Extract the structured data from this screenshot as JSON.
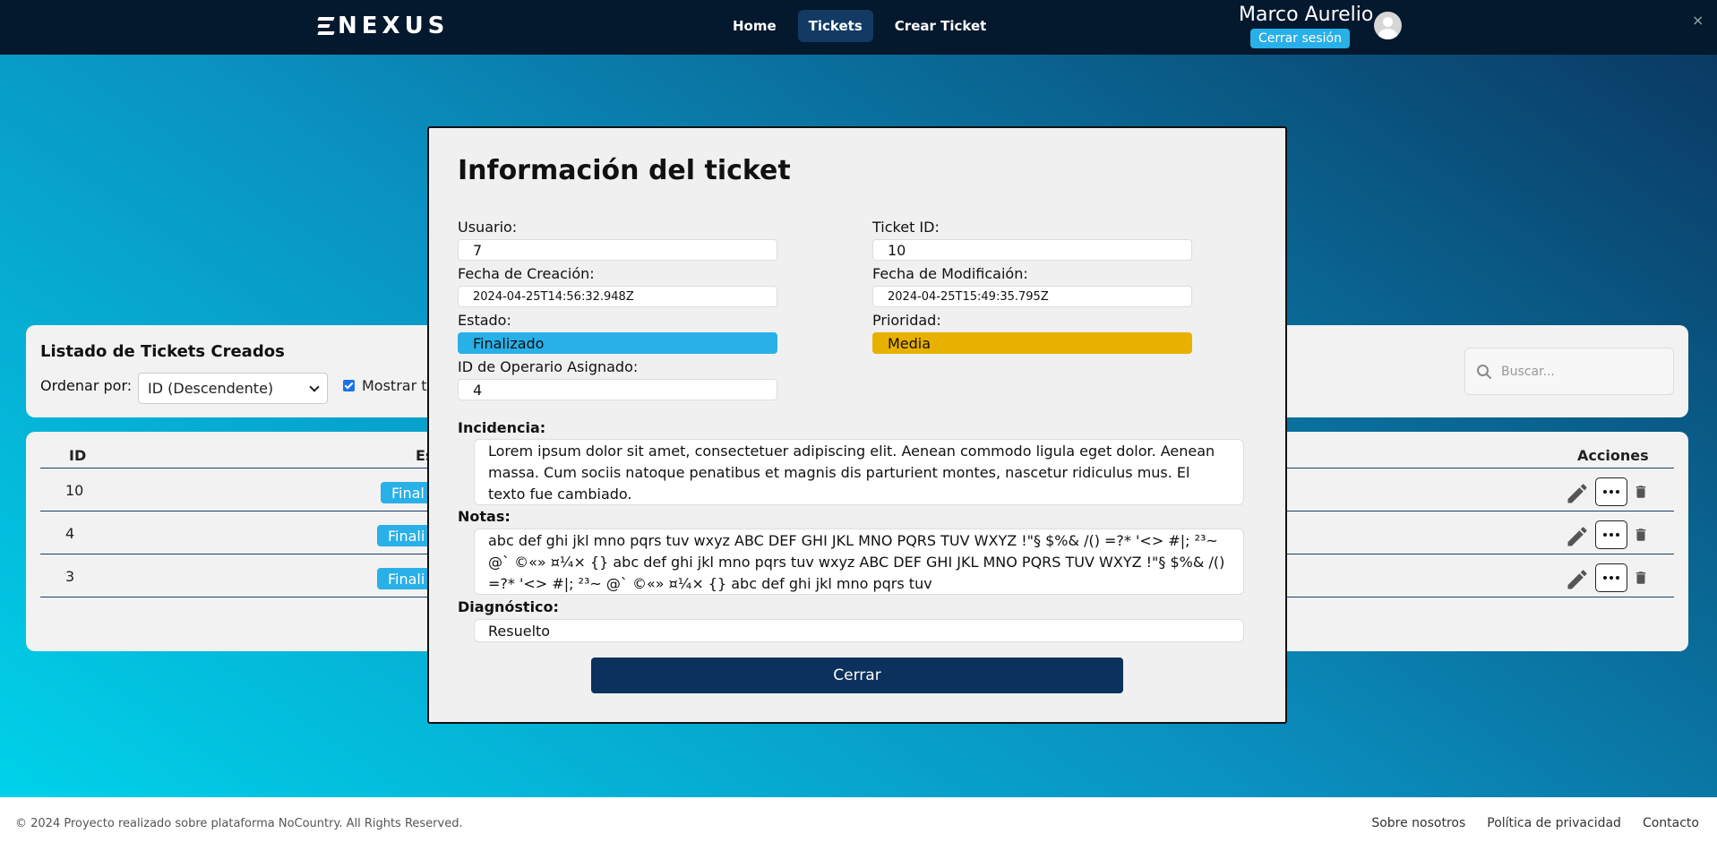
{
  "header": {
    "logo": "NEXUS",
    "nav": [
      {
        "label": "Home"
      },
      {
        "label": "Tickets"
      },
      {
        "label": "Crear Ticket"
      }
    ],
    "user_name": "Marco Aurelio",
    "logout_label": "Cerrar sesión",
    "close_glyph": "×"
  },
  "list": {
    "title": "Listado de Tickets Creados",
    "order_label": "Ordenar por:",
    "order_value": "ID (Descendente)",
    "show_all_label": "Mostrar to",
    "search_placeholder": "Buscar..."
  },
  "table": {
    "columns": {
      "id": "ID",
      "estado": "Es",
      "acciones": "Acciones"
    },
    "rows": [
      {
        "id": "10",
        "status": "Final"
      },
      {
        "id": "4",
        "status": "Finali"
      },
      {
        "id": "3",
        "status": "Finali"
      }
    ]
  },
  "modal": {
    "title": "Información del ticket",
    "usuario_label": "Usuario:",
    "usuario_value": "7",
    "ticket_id_label": "Ticket ID:",
    "ticket_id_value": "10",
    "fecha_creacion_label": "Fecha de Creación:",
    "fecha_creacion_value": "2024-04-25T14:56:32.948Z",
    "fecha_mod_label": "Fecha de Modificaión:",
    "fecha_mod_value": "2024-04-25T15:49:35.795Z",
    "estado_label": "Estado:",
    "estado_value": "Finalizado",
    "prioridad_label": "Prioridad:",
    "prioridad_value": "Media",
    "operario_label": "ID de Operario Asignado:",
    "operario_value": "4",
    "incidencia_label": "Incidencia:",
    "incidencia_value": "Lorem ipsum dolor sit amet, consectetuer adipiscing elit. Aenean commodo ligula eget dolor. Aenean massa. Cum sociis natoque penatibus et magnis dis parturient montes, nascetur ridiculus mus. El texto fue cambiado.",
    "notas_label": "Notas:",
    "notas_value": "abc def ghi jkl mno pqrs tuv wxyz ABC DEF GHI JKL MNO PQRS TUV WXYZ !\"§ $%& /() =?* '<> #|; ²³~ @` ©«» ¤¼× {} abc def ghi jkl mno pqrs tuv wxyz ABC DEF GHI JKL MNO PQRS TUV WXYZ !\"§ $%& /() =?* '<> #|; ²³~ @` ©«» ¤¼× {} abc def ghi jkl mno pqrs tuv",
    "diagnostico_label": "Diagnóstico:",
    "diagnostico_value": "Resuelto",
    "close_button": "Cerrar"
  },
  "footer": {
    "copyright": "© 2024 Proyecto realizado sobre plataforma NoCountry. All Rights Reserved.",
    "links": [
      {
        "label": "Sobre nosotros"
      },
      {
        "label": "Política de privacidad"
      },
      {
        "label": "Contacto"
      }
    ]
  },
  "colors": {
    "header_bg": "#04182e",
    "accent_blue": "#29b0e8",
    "priority_yellow": "#e8b100",
    "primary_dark": "#0b315c"
  }
}
